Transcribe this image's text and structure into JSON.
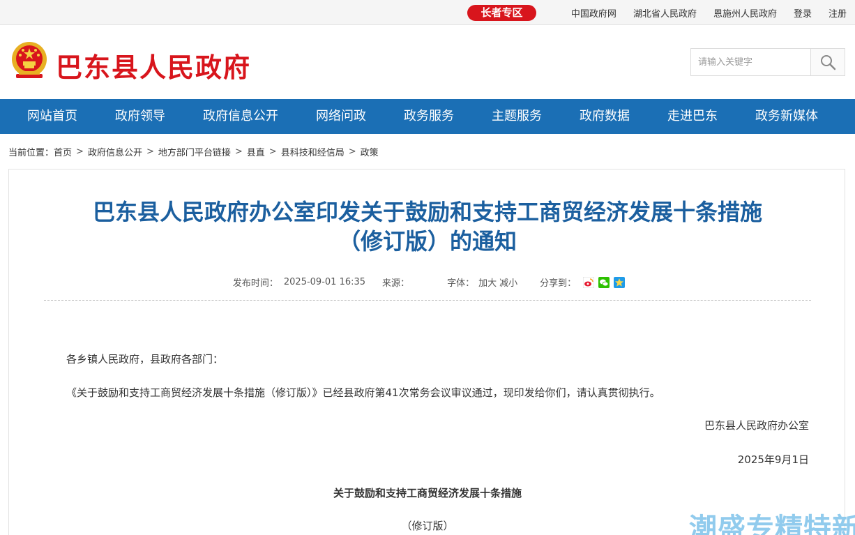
{
  "topbar": {
    "elder_zone": "长者专区",
    "links": [
      "中国政府网",
      "湖北省人民政府",
      "恩施州人民政府",
      "登录",
      "注册"
    ]
  },
  "header": {
    "site_title": "巴东县人民政府",
    "search_placeholder": "请输入关键字",
    "title_color": "#d8151c"
  },
  "nav": {
    "bg_color": "#1b6fb5",
    "items": [
      "网站首页",
      "政府领导",
      "政府信息公开",
      "网络问政",
      "政务服务",
      "主题服务",
      "政府数据",
      "走进巴东",
      "政务新媒体"
    ]
  },
  "breadcrumb": {
    "prefix": "当前位置：",
    "items": [
      "首页",
      "政府信息公开",
      "地方部门平台链接",
      "县直",
      "县科技和经信局",
      "政策"
    ],
    "separator": ">"
  },
  "article": {
    "title_line1": "巴东县人民政府办公室印发关于鼓励和支持工商贸经济发展十条措施",
    "title_line2": "（修订版）的通知",
    "meta": {
      "publish_label": "发布时间：",
      "publish_time": "2025-09-01 16:35",
      "source_label": "来源：",
      "font_label": "字体：",
      "font_larger": "加大",
      "font_smaller": "减小",
      "share_label": "分享到："
    },
    "greeting": "各乡镇人民政府，县政府各部门：",
    "body": "《关于鼓励和支持工商贸经济发展十条措施（修订版）》已经县政府第41次常务会议审议通过，现印发给你们，请认真贯彻执行。",
    "signature": "巴东县人民政府办公室",
    "date": "2025年9月1日",
    "subtitle": "关于鼓励和支持工商贸经济发展十条措施",
    "revision": "（修订版）"
  },
  "watermark": "潮盛专精特新"
}
